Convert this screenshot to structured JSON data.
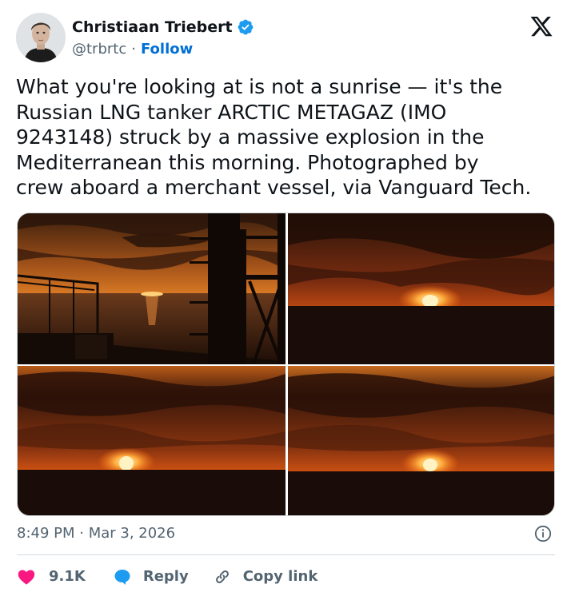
{
  "author": {
    "name": "Christiaan Triebert",
    "handle": "@trbrtc",
    "separator": "·",
    "follow_label": "Follow",
    "verified": true
  },
  "brand": {
    "icon": "x-logo-icon"
  },
  "tweet": {
    "text": "What you're looking at is not a sunrise — it's the\nRussian LNG tanker ARCTIC METAGAZ (IMO\n9243148) struck by a massive explosion in the\nMediterranean this morning. Photographed by\ncrew aboard a merchant vessel, via Vanguard Tech.",
    "timestamp": "8:49 PM · Mar 3, 2026"
  },
  "photos": [
    {
      "icon": "sunset-ship-deck-photo"
    },
    {
      "icon": "explosion-horizon-photo"
    },
    {
      "icon": "explosion-horizon-photo"
    },
    {
      "icon": "explosion-horizon-photo"
    }
  ],
  "actions": {
    "like_count": "9.1K",
    "reply_label": "Reply",
    "copy_link_label": "Copy link"
  },
  "colors": {
    "accent": "#1d9bf0",
    "follow": "#006fd6",
    "like": "#f91880",
    "muted": "#536471",
    "divider": "#cfd9de"
  }
}
